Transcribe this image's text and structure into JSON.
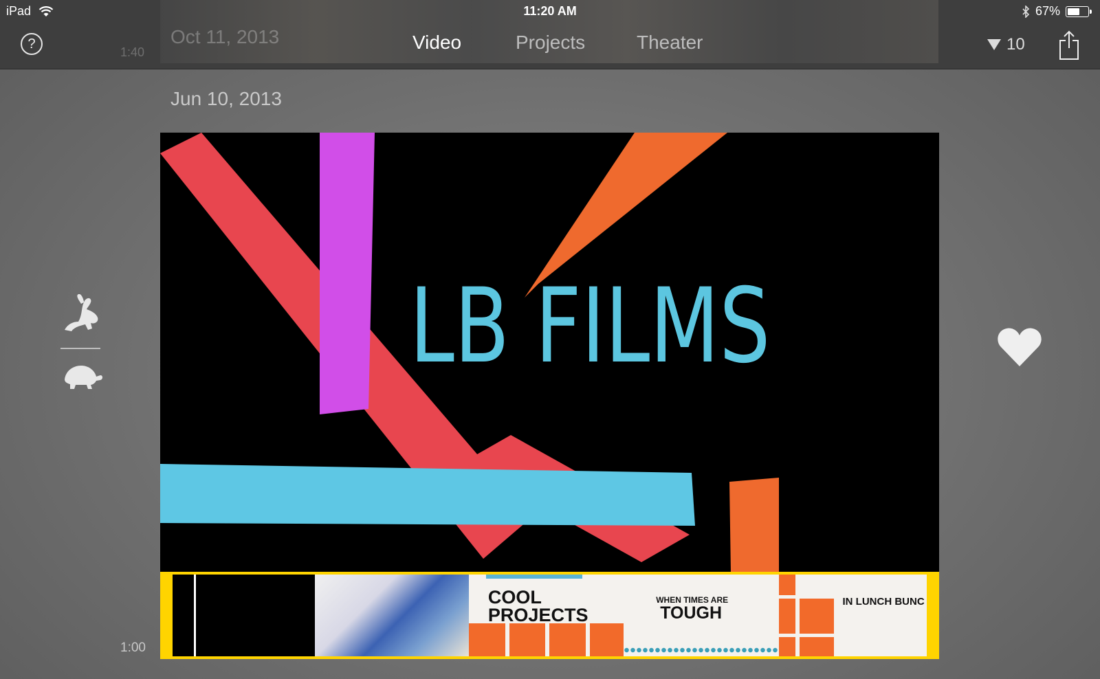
{
  "status_bar": {
    "device": "iPad",
    "time": "11:20 AM",
    "battery": "67%",
    "battery_level": 0.67
  },
  "header": {
    "help_label": "?",
    "ghost_date": "Oct 11, 2013",
    "ghost_duration": "1:40",
    "tabs": [
      {
        "label": "Video",
        "active": true
      },
      {
        "label": "Projects",
        "active": false
      },
      {
        "label": "Theater",
        "active": false
      }
    ],
    "filter_count": "10"
  },
  "main": {
    "date_label": "Jun 10, 2013",
    "video_title": "LB FILMS",
    "clip_duration": "1:00"
  },
  "filmstrip": {
    "frames": [
      {
        "kind": "black"
      },
      {
        "kind": "photo"
      },
      {
        "kind": "title",
        "line1": "COOL",
        "line2": "PROJECTS"
      },
      {
        "kind": "title",
        "small": "WHEN TIMES ARE",
        "big": "TOUGH"
      },
      {
        "kind": "title",
        "text": "IN LUNCH BUNC"
      }
    ]
  },
  "icons": {
    "fast": "rabbit-icon",
    "slow": "turtle-icon",
    "favorite": "heart-icon",
    "share": "share-icon",
    "bluetooth": "bluetooth-icon",
    "wifi": "wifi-icon"
  },
  "colors": {
    "accent_yellow": "#ffd400",
    "title_blue": "#5cc6e0",
    "stripe_red": "#e8464f",
    "stripe_magenta": "#d14ee8",
    "stripe_orange": "#ef6a2e",
    "stripe_cyan": "#5ec7e4"
  }
}
